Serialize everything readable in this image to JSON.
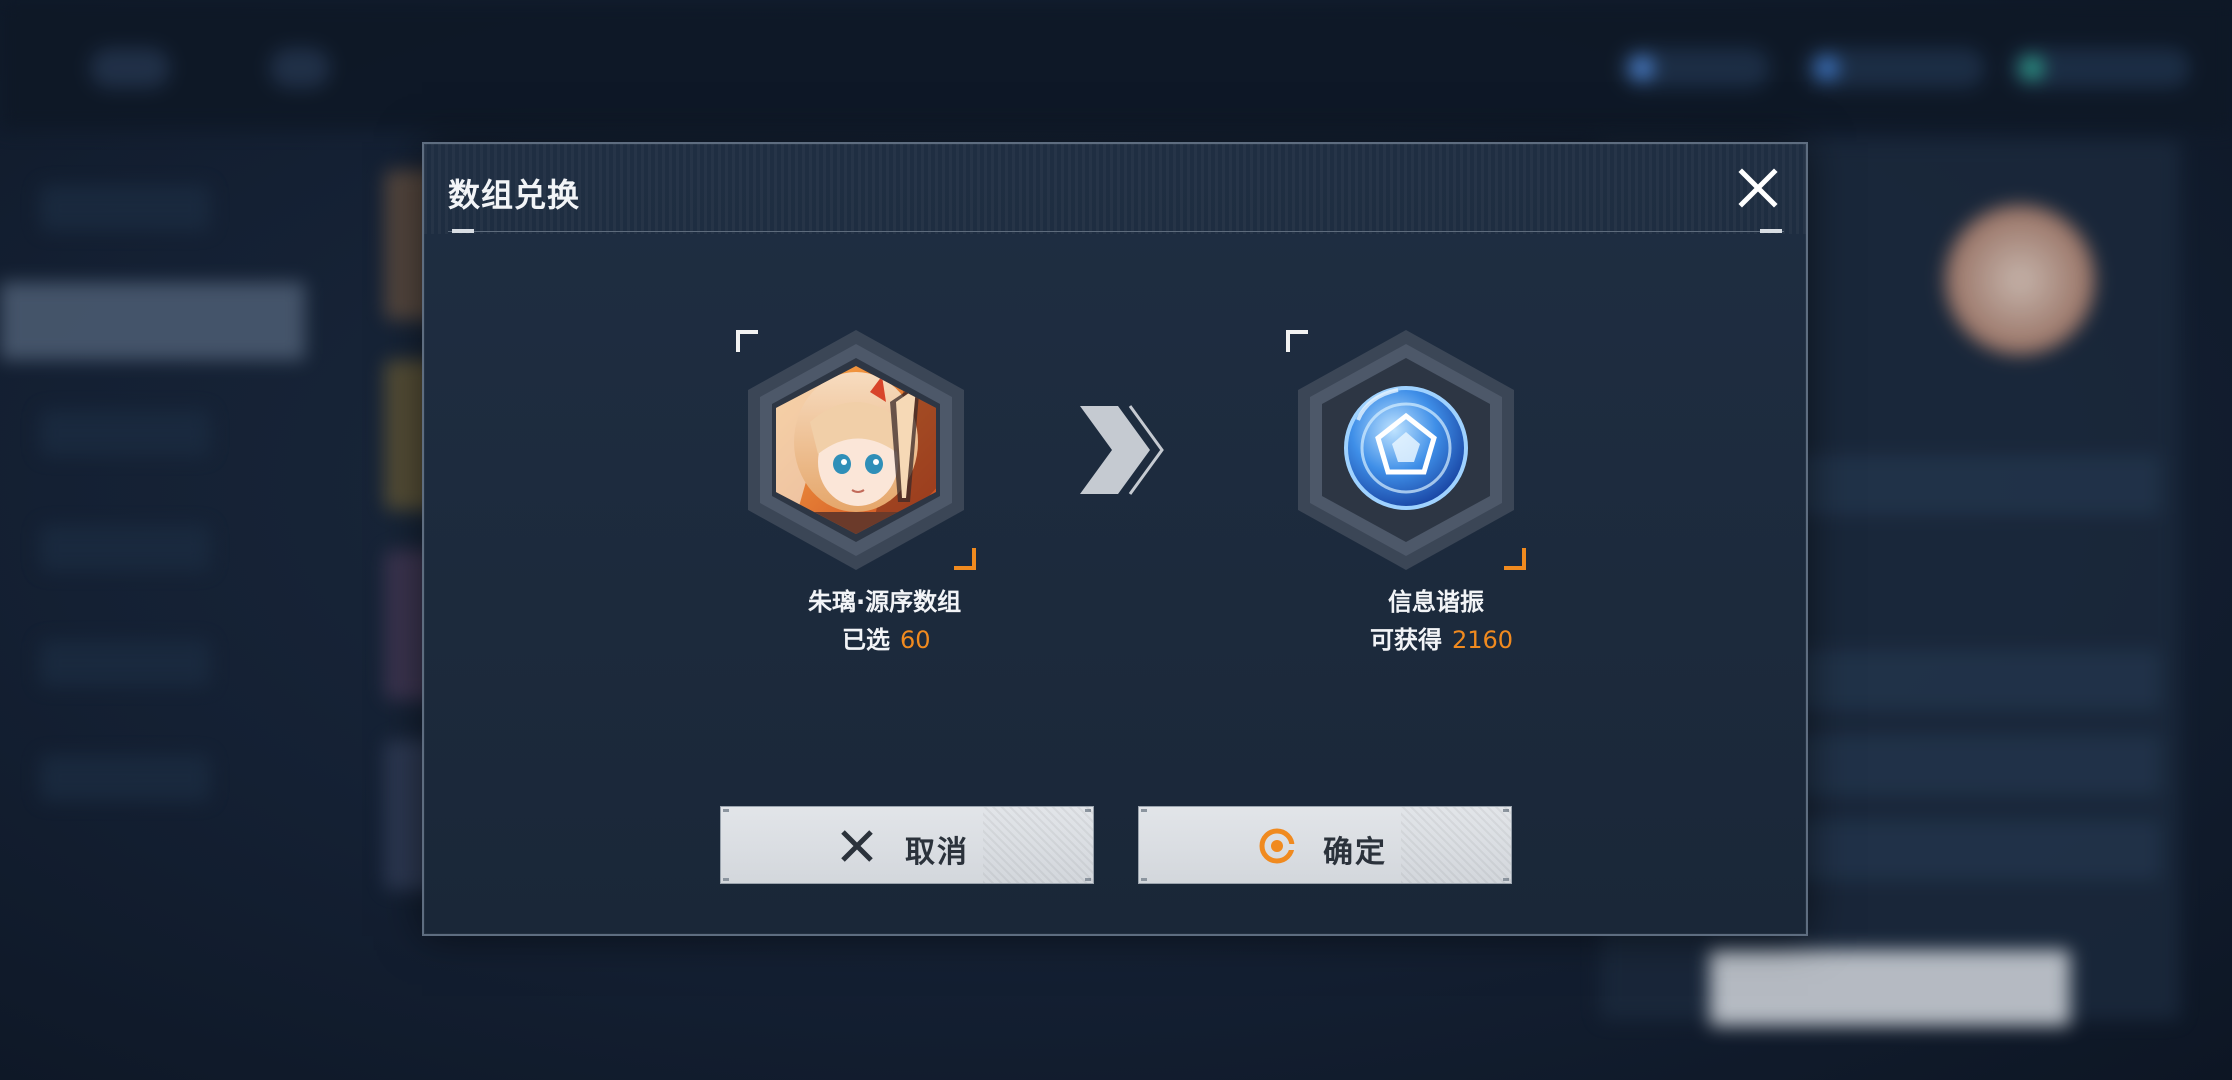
{
  "dialog": {
    "title": "数组兑换"
  },
  "source_item": {
    "name": "朱璃·源序数组",
    "selected_label": "已选",
    "selected_count": "60",
    "portrait_icon": "character-portrait-icon"
  },
  "target_item": {
    "name": "信息谐振",
    "obtain_label": "可获得",
    "obtain_count": "2160",
    "icon": "crystal-orb-icon"
  },
  "buttons": {
    "cancel_label": "取消",
    "confirm_label": "确定"
  },
  "colors": {
    "accent": "#f08a1f",
    "panel": "#1f2e42",
    "button": "#dcdfe3"
  }
}
